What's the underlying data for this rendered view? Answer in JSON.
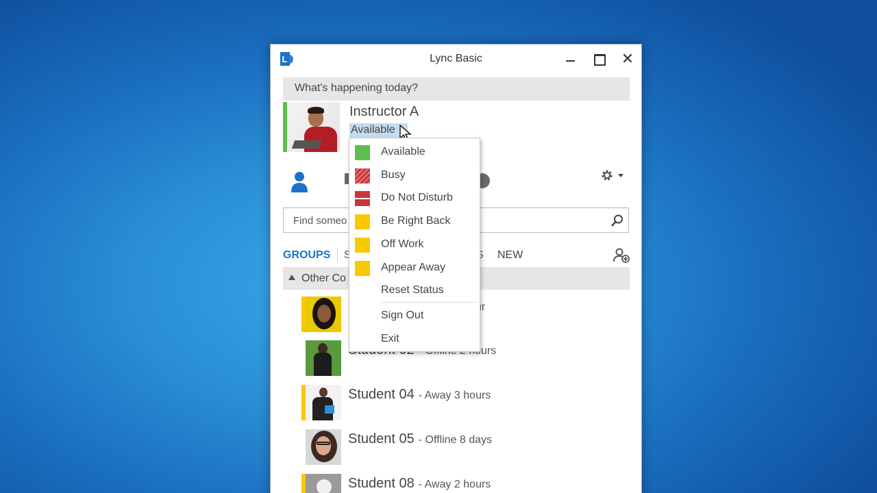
{
  "window": {
    "title": "Lync Basic",
    "whats_happening": "What's happening today?"
  },
  "user": {
    "name": "Instructor A",
    "status": "Available",
    "presence_color": "#5cc04e"
  },
  "search": {
    "placeholder": "Find someo"
  },
  "tabs": {
    "groups": "GROUPS",
    "status_partial": "S",
    "relationships_partial": "S",
    "new": "NEW"
  },
  "group": {
    "label": "Other Co"
  },
  "contacts": [
    {
      "name": "",
      "status": "ur",
      "presence_color": "#f7c900"
    },
    {
      "name": "Student 02",
      "status": "- Offline 2 hours",
      "presence_color": "#ffffff"
    },
    {
      "name": "Student 04",
      "status": "- Away 3 hours",
      "presence_color": "#f7c900"
    },
    {
      "name": "Student 05",
      "status": "- Offline 8 days",
      "presence_color": "#ffffff"
    },
    {
      "name": "Student 08",
      "status": "- Away 2 hours",
      "presence_color": "#f7c900"
    }
  ],
  "status_menu": {
    "items": [
      {
        "label": "Available",
        "icon": "available-icon",
        "color": "#5cc04e"
      },
      {
        "label": "Busy",
        "icon": "busy-icon",
        "color": "#c9363a"
      },
      {
        "label": "Do Not Disturb",
        "icon": "do-not-disturb-icon",
        "color": "#c9363a"
      },
      {
        "label": "Be Right Back",
        "icon": "be-right-back-icon",
        "color": "#f7c900"
      },
      {
        "label": "Off Work",
        "icon": "off-work-icon",
        "color": "#f7c900"
      },
      {
        "label": "Appear Away",
        "icon": "appear-away-icon",
        "color": "#f7c900"
      },
      {
        "label": "Reset Status"
      },
      {
        "label": "Sign Out"
      },
      {
        "label": "Exit"
      }
    ]
  }
}
